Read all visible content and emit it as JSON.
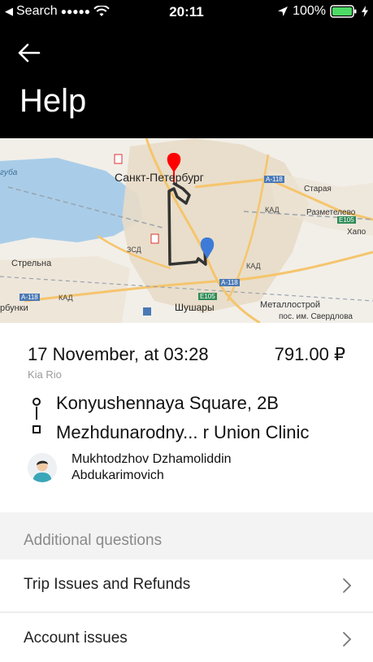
{
  "status_bar": {
    "carrier_back": "Search",
    "signal": "●●●●●",
    "time": "20:11",
    "battery": "100%"
  },
  "header": {
    "title": "Help"
  },
  "map": {
    "city_label": "Санкт-Петербург",
    "labels": {
      "guba": "губа",
      "strelna": "Стрельна",
      "rbunki": "рбунки",
      "starya": "Старая",
      "razmetelevo": "Разметелево",
      "khapo": "Хапо",
      "shushary": "Шушары",
      "metallostroy": "Металлострой",
      "sverdlova": "пос. им. Свердлова",
      "kad1": "КАД",
      "kad2": "КАД",
      "kad3": "КАД",
      "zsd": "ЗСД",
      "a118_1": "A-118",
      "a118_2": "A-118",
      "a118_3": "A-118",
      "e105_1": "E105",
      "e105_2": "E105"
    },
    "colors": {
      "water": "#a9cde8",
      "land": "#f2efe9",
      "urban": "#e8dcc8",
      "road": "#f5c56d",
      "route": "#333333",
      "start_pin": "#ff0000",
      "end_pin": "#3d7bd9"
    }
  },
  "trip": {
    "date": "17 November, at 03:28",
    "price": "791.00 ₽",
    "car": "Kia Rio",
    "from": "Konyushennaya Square, 2B",
    "to": "Mezhdunarodny... r Union Clinic",
    "driver_line1": "Mukhtodzhov Dzhamoliddin",
    "driver_line2": "Abdukarimovich"
  },
  "questions": {
    "section_title": "Additional questions",
    "items": [
      {
        "label": "Trip Issues and Refunds"
      },
      {
        "label": "Account issues"
      }
    ]
  }
}
